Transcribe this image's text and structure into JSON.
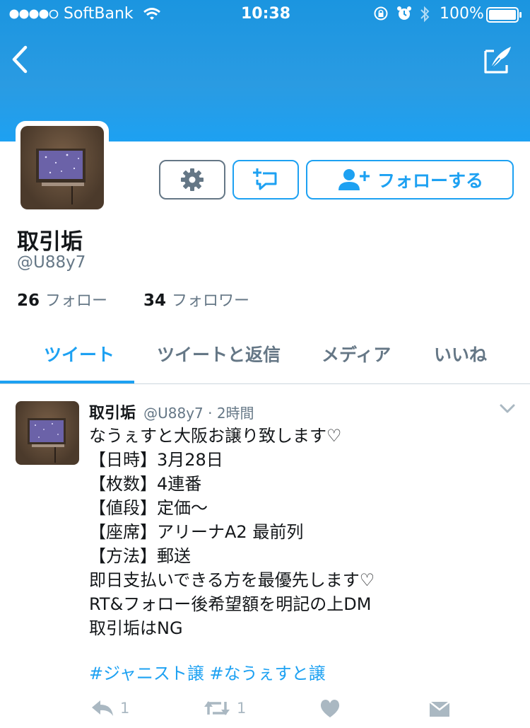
{
  "status_bar": {
    "carrier": "SoftBank",
    "time": "10:38",
    "battery": "100%"
  },
  "header": {
    "back_icon": "chevron-left",
    "compose_icon": "compose-quill"
  },
  "profile": {
    "name": "取引垢",
    "handle": "@U88y7",
    "follow_button_label": "フォローする",
    "following_count": "26",
    "following_label": "フォロー",
    "followers_count": "34",
    "followers_label": "フォロワー"
  },
  "tabs": [
    {
      "label": "ツイート",
      "active": true
    },
    {
      "label": "ツイートと返信",
      "active": false
    },
    {
      "label": "メディア",
      "active": false
    },
    {
      "label": "いいね",
      "active": false
    }
  ],
  "tweet": {
    "author_name": "取引垢",
    "meta": "@U88y7 · 2時間",
    "lines": [
      "なうぇすと大阪お譲り致します♡",
      "【日時】3月28日",
      "【枚数】4連番",
      "【値段】定価〜",
      "【座席】アリーナA2 最前列",
      "【方法】郵送",
      "即日支払いできる方を最優先します♡",
      "RT&フォロー後希望額を明記の上DM",
      "取引垢はNG"
    ],
    "hashtags": "#ジャニスト譲 #なうぇすと譲",
    "reply_count": "1",
    "retweet_count": "1"
  },
  "colors": {
    "accent": "#1da1f2",
    "header_blue": "#1b95e0",
    "muted_text": "#657786",
    "icon_gray": "#aab8c2"
  }
}
